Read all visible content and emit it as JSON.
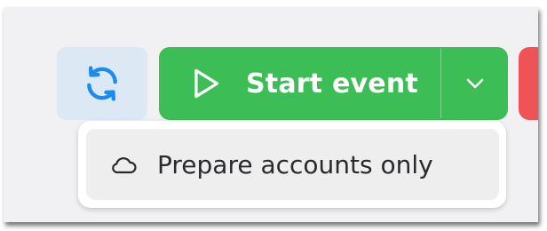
{
  "toolbar": {
    "refresh_icon": "refresh-icon",
    "start_label": "Start event",
    "start_icon": "play-icon",
    "dropdown_icon": "chevron-down-icon"
  },
  "dropdown": {
    "items": [
      {
        "label": "Prepare accounts only",
        "icon": "cloud-icon"
      }
    ]
  },
  "colors": {
    "primary_green": "#3cbd56",
    "refresh_bg": "#dde8f5",
    "refresh_icon": "#1a8cf0",
    "danger_red": "#ef5356"
  }
}
